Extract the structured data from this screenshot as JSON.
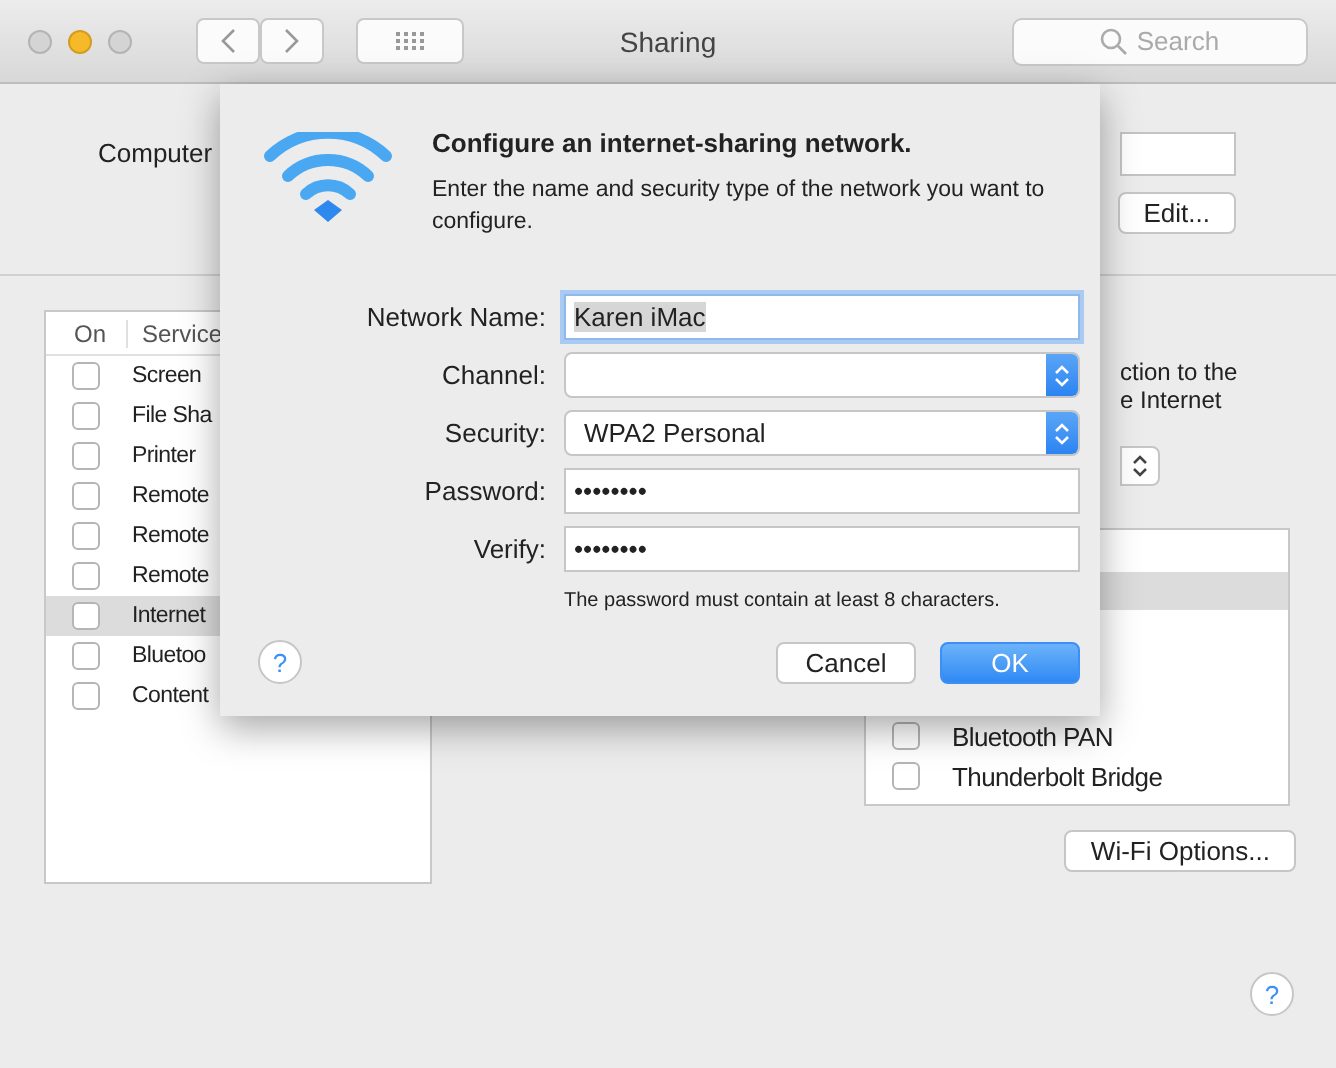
{
  "window": {
    "title": "Sharing",
    "search_placeholder": "Search"
  },
  "computer_name": {
    "label": "Computer",
    "edit_button": "Edit..."
  },
  "services": {
    "columns": [
      "On",
      "Service"
    ],
    "rows": [
      {
        "name": "Screen",
        "checked": false,
        "selected": false
      },
      {
        "name": "File Sha",
        "checked": false,
        "selected": false
      },
      {
        "name": "Printer",
        "checked": false,
        "selected": false
      },
      {
        "name": "Remote",
        "checked": false,
        "selected": false
      },
      {
        "name": "Remote",
        "checked": false,
        "selected": false
      },
      {
        "name": "Remote",
        "checked": false,
        "selected": false
      },
      {
        "name": "Internet",
        "checked": false,
        "selected": true
      },
      {
        "name": "Bluetoo",
        "checked": false,
        "selected": false
      },
      {
        "name": "Content",
        "checked": false,
        "selected": false
      }
    ]
  },
  "right_panel": {
    "texts": [
      "ction to the",
      "e Internet"
    ],
    "ports": [
      {
        "name": "Bluetooth PAN",
        "checked": false
      },
      {
        "name": "Thunderbolt Bridge",
        "checked": false
      }
    ],
    "wifi_button": "Wi-Fi Options..."
  },
  "sheet": {
    "title": "Configure an internet-sharing network.",
    "description": "Enter the name and security type of the network you want to configure.",
    "fields": [
      {
        "label": "Network Name:",
        "kind": "text",
        "value": "Karen iMac",
        "focused": true
      },
      {
        "label": "Channel:",
        "kind": "popup"
      },
      {
        "label": "Security:",
        "kind": "popup",
        "value": "WPA2 Personal"
      },
      {
        "label": "Password:",
        "kind": "text",
        "value": "••••••••",
        "focused": false
      },
      {
        "label": "Verify:",
        "kind": "text",
        "value": "••••••••",
        "focused": false
      }
    ],
    "hint": "The password must contain at least 8 characters.",
    "buttons": [
      {
        "label": "Cancel",
        "default": false
      },
      {
        "label": "OK",
        "default": true
      }
    ],
    "help": "?"
  },
  "help": "?"
}
